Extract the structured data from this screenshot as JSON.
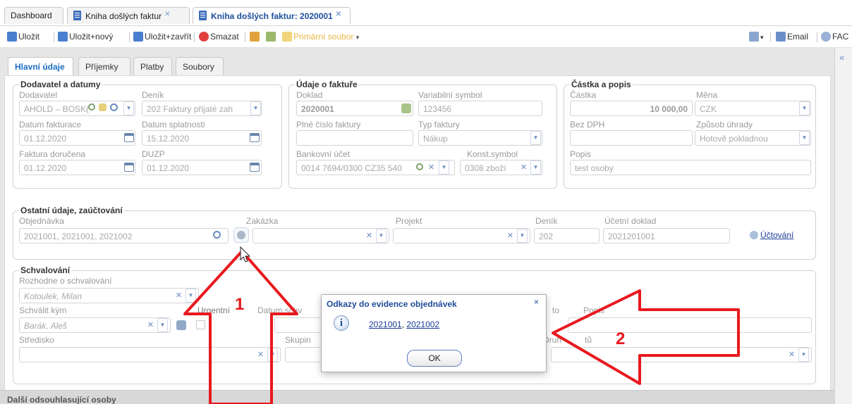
{
  "tabs": [
    {
      "label": "Dashboard"
    },
    {
      "label": "Kniha došlých faktur"
    },
    {
      "label": "Kniha došlých faktur: 2020001"
    }
  ],
  "toolbar": {
    "save": "Uložit",
    "save_new": "Uložit+nový",
    "save_close": "Uložit+zavřít",
    "delete": "Smazat",
    "primary_file": "Primární soubor",
    "email": "Email",
    "fac": "FAC"
  },
  "content_tabs": [
    "Hlavní údaje",
    "Příjemky",
    "Platby",
    "Soubory"
  ],
  "supplier": {
    "legend": "Dodavatel a datumy",
    "supplier_label": "Dodavatel",
    "supplier_value": "AHOLD – BOSK(",
    "journal_label": "Deník",
    "journal_value": "202 Faktury přijaté zah",
    "invoice_date_label": "Datum fakturace",
    "invoice_date": "01.12.2020",
    "due_date_label": "Datum splatnosti",
    "due_date": "15.12.2020",
    "delivered_label": "Faktura doručena",
    "delivered": "01.12.2020",
    "duzp_label": "DUZP",
    "duzp": "01.12.2020"
  },
  "invoice": {
    "legend": "Údaje o faktuře",
    "doc_label": "Doklad",
    "doc_value": "2020001",
    "varsym_label": "Variabilní symbol",
    "varsym_value": "123456",
    "full_no_label": "Plné číslo faktury",
    "full_no_value": "",
    "type_label": "Typ faktury",
    "type_value": "Nákup",
    "bank_label": "Bankovní účet",
    "bank_value": "0014 7694/0300 CZ35 540",
    "const_label": "Konst.symbol",
    "const_value": "0308 zboží"
  },
  "amount": {
    "legend": "Částka a popis",
    "amount_label": "Částka",
    "amount_value": "10 000,00",
    "currency_label": "Měna",
    "currency_value": "CZK",
    "novat_label": "Bez DPH",
    "novat_value": "",
    "payment_label": "Způsob úhrady",
    "payment_value": "Hotově pokladnou",
    "desc_label": "Popis",
    "desc_value": "test osoby"
  },
  "other": {
    "legend": "Ostatní údaje, zaúčtování",
    "order_label": "Objednávka",
    "order_value": "2021001, 2021001, 2021002",
    "job_label": "Zakázka",
    "project_label": "Projekt",
    "journal_label": "Deník",
    "journal_value": "202",
    "accdoc_label": "Účetní doklad",
    "accdoc_value": "2021201001",
    "posting_link": "Účtování"
  },
  "approval": {
    "legend": "Schvalování",
    "decides_label": "Rozhodne o schvalování",
    "decides_value": "Kotoulek, Milan",
    "approve_by_label": "Schválit kým",
    "approve_by_value": "Barák, Aleš",
    "urgent_label": "Urgentní",
    "date_label_part": "Datum schv",
    "center_label": "Středisko",
    "group_label_part": "Skupin",
    "cost_type_label_part": "Druh",
    "cost_type_label_tail": "tů",
    "note_label_part": "Popis",
    "to_fragment": "to"
  },
  "footer_section": "Další odsouhlasující osoby",
  "dialog": {
    "title": "Odkazy do evidence objednávek",
    "close": "×",
    "link1": "2021001",
    "separator": ", ",
    "link2": "2021002",
    "ok": "OK"
  },
  "annotations": {
    "label1": "1",
    "label2": "2",
    "color": "#e8191e"
  }
}
